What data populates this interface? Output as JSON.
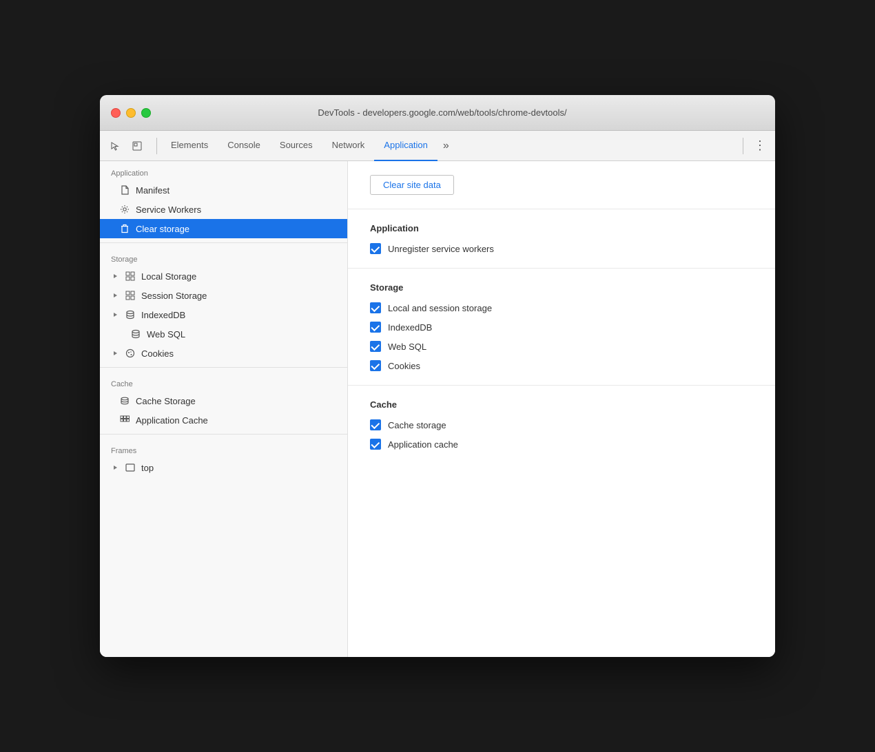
{
  "window": {
    "title": "DevTools - developers.google.com/web/tools/chrome-devtools/",
    "trafficLights": {
      "close": "close-button",
      "minimize": "minimize-button",
      "maximize": "maximize-button"
    }
  },
  "toolbar": {
    "icons": [
      {
        "name": "cursor-icon",
        "symbol": "↖",
        "label": "Cursor"
      },
      {
        "name": "inspect-icon",
        "symbol": "◱",
        "label": "Inspect"
      }
    ],
    "tabs": [
      {
        "id": "elements",
        "label": "Elements",
        "active": false
      },
      {
        "id": "console",
        "label": "Console",
        "active": false
      },
      {
        "id": "sources",
        "label": "Sources",
        "active": false
      },
      {
        "id": "network",
        "label": "Network",
        "active": false
      },
      {
        "id": "application",
        "label": "Application",
        "active": true
      }
    ],
    "moreLabel": "»",
    "settingsIcon": "⋮"
  },
  "sidebar": {
    "sections": [
      {
        "id": "application",
        "header": "Application",
        "items": [
          {
            "id": "manifest",
            "label": "Manifest",
            "icon": "file",
            "indent": 1,
            "hasArrow": false
          },
          {
            "id": "service-workers",
            "label": "Service Workers",
            "icon": "gear",
            "indent": 1,
            "hasArrow": false
          },
          {
            "id": "clear-storage",
            "label": "Clear storage",
            "icon": "trash",
            "indent": 1,
            "hasArrow": false,
            "active": true
          }
        ]
      },
      {
        "id": "storage",
        "header": "Storage",
        "items": [
          {
            "id": "local-storage",
            "label": "Local Storage",
            "icon": "grid",
            "indent": 1,
            "hasArrow": true
          },
          {
            "id": "session-storage",
            "label": "Session Storage",
            "icon": "grid",
            "indent": 1,
            "hasArrow": true
          },
          {
            "id": "indexeddb",
            "label": "IndexedDB",
            "icon": "db",
            "indent": 1,
            "hasArrow": true
          },
          {
            "id": "web-sql",
            "label": "Web SQL",
            "icon": "db",
            "indent": 2,
            "hasArrow": false
          },
          {
            "id": "cookies",
            "label": "Cookies",
            "icon": "cookie",
            "indent": 1,
            "hasArrow": true
          }
        ]
      },
      {
        "id": "cache",
        "header": "Cache",
        "items": [
          {
            "id": "cache-storage",
            "label": "Cache Storage",
            "icon": "stack",
            "indent": 2,
            "hasArrow": false
          },
          {
            "id": "application-cache",
            "label": "Application Cache",
            "icon": "appgrid",
            "indent": 2,
            "hasArrow": false
          }
        ]
      },
      {
        "id": "frames",
        "header": "Frames",
        "items": [
          {
            "id": "top-frame",
            "label": "top",
            "icon": "frame",
            "indent": 1,
            "hasArrow": true
          }
        ]
      }
    ]
  },
  "content": {
    "clearButton": "Clear site data",
    "sections": [
      {
        "id": "application-section",
        "title": "Application",
        "items": [
          {
            "id": "unregister-sw",
            "label": "Unregister service workers",
            "checked": true
          }
        ]
      },
      {
        "id": "storage-section",
        "title": "Storage",
        "items": [
          {
            "id": "local-session-storage",
            "label": "Local and session storage",
            "checked": true
          },
          {
            "id": "indexeddb-cb",
            "label": "IndexedDB",
            "checked": true
          },
          {
            "id": "web-sql-cb",
            "label": "Web SQL",
            "checked": true
          },
          {
            "id": "cookies-cb",
            "label": "Cookies",
            "checked": true
          }
        ]
      },
      {
        "id": "cache-section",
        "title": "Cache",
        "items": [
          {
            "id": "cache-storage-cb",
            "label": "Cache storage",
            "checked": true
          },
          {
            "id": "application-cache-cb",
            "label": "Application cache",
            "checked": true
          }
        ]
      }
    ]
  }
}
